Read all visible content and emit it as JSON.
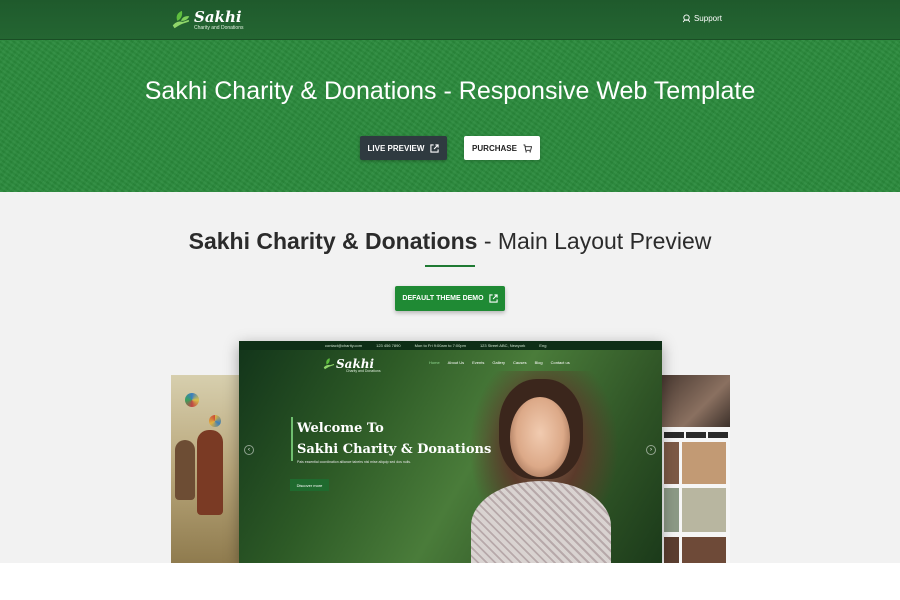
{
  "header": {
    "logo_name": "Sakhi",
    "logo_tagline": "Charity and Donations",
    "support_label": "Support",
    "support_icon": "headset-icon"
  },
  "hero": {
    "title_main": "Sakhi Charity & Donations",
    "title_rest": " - Responsive Web Template",
    "live_preview_label": "LIVE PREVIEW",
    "purchase_label": "PURCHASE",
    "colors": {
      "background": "#2a8a3c",
      "preview_button": "#2f3a40"
    }
  },
  "main": {
    "title_main": "Sakhi Charity & Donations",
    "title_rest": " - Main Layout Preview",
    "demo_button_label": "DEFAULT THEME DEMO",
    "accent": "#1f8a34"
  },
  "preview": {
    "top_info": [
      "contact@charity.com",
      "123 456 7890",
      "Mon to Fri 9:00am to 7:00pm",
      "123 Street ABC, Newyork",
      "Eng"
    ],
    "logo": "Sakhi",
    "logo_tagline": "Charity and Donations",
    "nav": [
      "Home",
      "About Us",
      "Events",
      "Gallery",
      "Causes",
      "Blog",
      "Contact us"
    ],
    "heading_line1": "Welcome To",
    "heading_line2": "Sakhi Charity & Donations",
    "subtext": "Pais essential coordination alliance tabeirs nisl mise aliquip sed dos nulis.",
    "cta": "Discover more"
  }
}
